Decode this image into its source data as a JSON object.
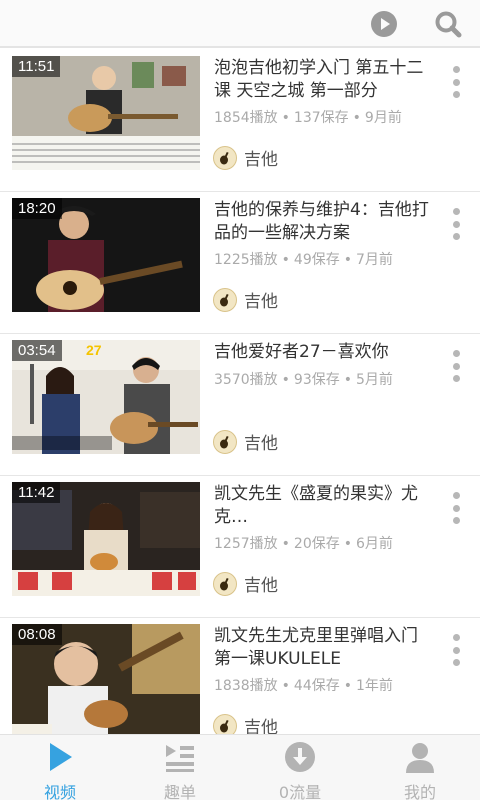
{
  "header": {
    "play_icon": "play-circle-icon",
    "search_icon": "search-icon"
  },
  "videos": [
    {
      "duration": "11:51",
      "title": "泡泡吉他初学入门 第五十二课 天空之城 第一部分",
      "plays": "1854播放",
      "saves": "137保存",
      "age": "9月前",
      "author": "吉他"
    },
    {
      "duration": "18:20",
      "title": "吉他的保养与维护4：吉他打品的一些解决方案",
      "plays": "1225播放",
      "saves": "49保存",
      "age": "7月前",
      "author": "吉他"
    },
    {
      "duration": "03:54",
      "thumb_caption": "27",
      "title": "吉他爱好者27－喜欢你",
      "plays": "3570播放",
      "saves": "93保存",
      "age": "5月前",
      "author": "吉他"
    },
    {
      "duration": "11:42",
      "title": "凯文先生《盛夏的果实》尤克…",
      "plays": "1257播放",
      "saves": "20保存",
      "age": "6月前",
      "author": "吉他"
    },
    {
      "duration": "08:08",
      "title": "凯文先生尤克里里弹唱入门第一课UKULELE",
      "plays": "1838播放",
      "saves": "44保存",
      "age": "1年前",
      "author": "吉他"
    }
  ],
  "meta_separator": "•",
  "tabs": [
    {
      "label": "视频",
      "icon": "play-triangle-icon",
      "active": true
    },
    {
      "label": "趣单",
      "icon": "playlist-icon",
      "active": false
    },
    {
      "label": "0流量",
      "icon": "download-icon",
      "active": false
    },
    {
      "label": "我的",
      "icon": "person-icon",
      "active": false
    }
  ],
  "colors": {
    "accent": "#36a2e0",
    "inactive": "#b3b3b3",
    "meta": "#aaaaaa"
  }
}
